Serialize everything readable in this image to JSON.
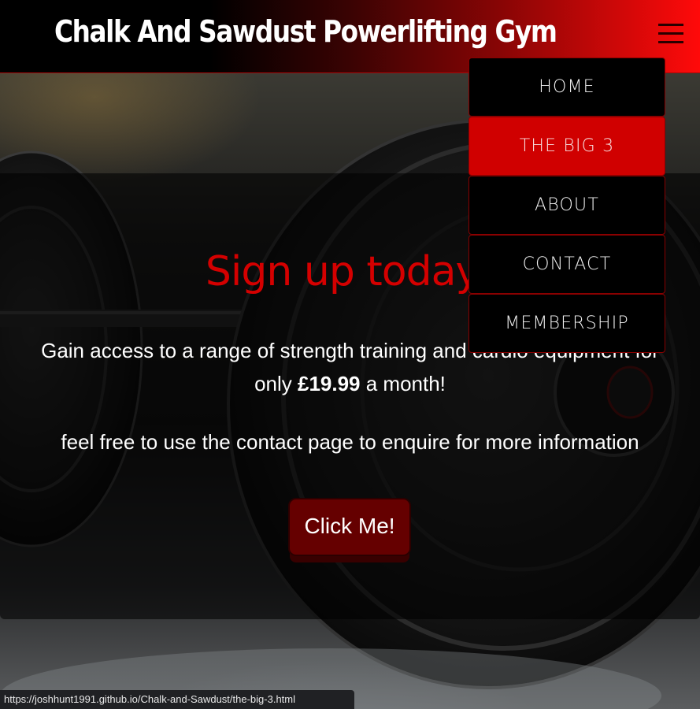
{
  "header": {
    "site_title": "Chalk And Sawdust Powerlifting Gym",
    "menu_icon": "hamburger-menu-icon"
  },
  "nav": {
    "items": [
      {
        "label": "HOME",
        "active": false
      },
      {
        "label": "THE BIG 3",
        "active": true
      },
      {
        "label": "ABOUT",
        "active": false
      },
      {
        "label": "CONTACT",
        "active": false
      },
      {
        "label": "MEMBERSHIP",
        "active": false
      }
    ]
  },
  "hero": {
    "heading": "Sign up today!",
    "text_part1": "Gain access to a range of strength training and cardio equipment for only ",
    "price": "£19.99",
    "text_part2": " a month!",
    "note": "feel free to use the contact page to enquire for more information",
    "button_label": "Click Me!"
  },
  "status_bar": {
    "url": "https://joshhunt1991.github.io/Chalk-and-Sawdust/the-big-3.html"
  },
  "colors": {
    "accent_red": "#d00000",
    "heading_red": "#d40000",
    "button_dark_red": "#650000"
  }
}
